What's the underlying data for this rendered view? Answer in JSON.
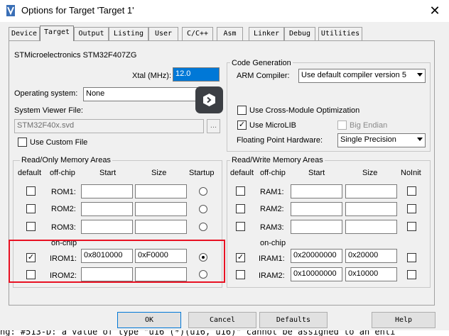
{
  "window": {
    "title": "Options for Target 'Target 1'",
    "close_glyph": "✕"
  },
  "tabs": [
    "Device",
    "Target",
    "Output",
    "Listing",
    "User",
    "C/C++",
    "Asm",
    "Linker",
    "Debug",
    "Utilities"
  ],
  "active_tab": "Target",
  "device": {
    "name": "STMicroelectronics STM32F407ZG"
  },
  "xtal": {
    "label": "Xtal (MHz):",
    "value": "12.0"
  },
  "operating_system": {
    "label": "Operating system:",
    "value": "None"
  },
  "system_viewer": {
    "label": "System Viewer File:",
    "value": "STM32F40x.svd",
    "browse_label": "...",
    "use_custom_label": "Use Custom File"
  },
  "code_generation": {
    "title": "Code Generation",
    "arm_compiler_label": "ARM Compiler:",
    "arm_compiler_value": "Use default compiler version 5",
    "cross_module_label": "Use Cross-Module Optimization",
    "microlib_label": "Use MicroLIB",
    "big_endian_label": "Big Endian",
    "fp_label": "Floating Point Hardware:",
    "fp_value": "Single Precision"
  },
  "rom_group": {
    "title": "Read/Only Memory Areas",
    "headers": {
      "default": "default",
      "offchip": "off-chip",
      "start": "Start",
      "size": "Size",
      "startup": "Startup"
    },
    "onchip_label": "on-chip",
    "rows": [
      {
        "label": "ROM1:",
        "start": "",
        "size": ""
      },
      {
        "label": "ROM2:",
        "start": "",
        "size": ""
      },
      {
        "label": "ROM3:",
        "start": "",
        "size": ""
      },
      {
        "label": "IROM1:",
        "start": "0x8010000",
        "size": "0xF0000"
      },
      {
        "label": "IROM2:",
        "start": "",
        "size": ""
      }
    ]
  },
  "ram_group": {
    "title": "Read/Write Memory Areas",
    "headers": {
      "default": "default",
      "offchip": "off-chip",
      "start": "Start",
      "size": "Size",
      "noinit": "NoInit"
    },
    "onchip_label": "on-chip",
    "rows": [
      {
        "label": "RAM1:",
        "start": "",
        "size": ""
      },
      {
        "label": "RAM2:",
        "start": "",
        "size": ""
      },
      {
        "label": "RAM3:",
        "start": "",
        "size": ""
      },
      {
        "label": "IRAM1:",
        "start": "0x20000000",
        "size": "0x20000"
      },
      {
        "label": "IRAM2:",
        "start": "0x10000000",
        "size": "0x10000"
      }
    ]
  },
  "buttons": {
    "ok": "OK",
    "cancel": "Cancel",
    "defaults": "Defaults",
    "help": "Help"
  },
  "status_line": "ng:  #513-D: a value of type \"u16 (*)(u16, u16)\" cannot be assigned to an enti",
  "colors": {
    "highlight": "#e81123",
    "selection": "#0078d7",
    "float_icon_bg": "#3c3f44"
  },
  "icons": {
    "app": "keil-options-icon",
    "float": "floating-assistant-icon"
  }
}
